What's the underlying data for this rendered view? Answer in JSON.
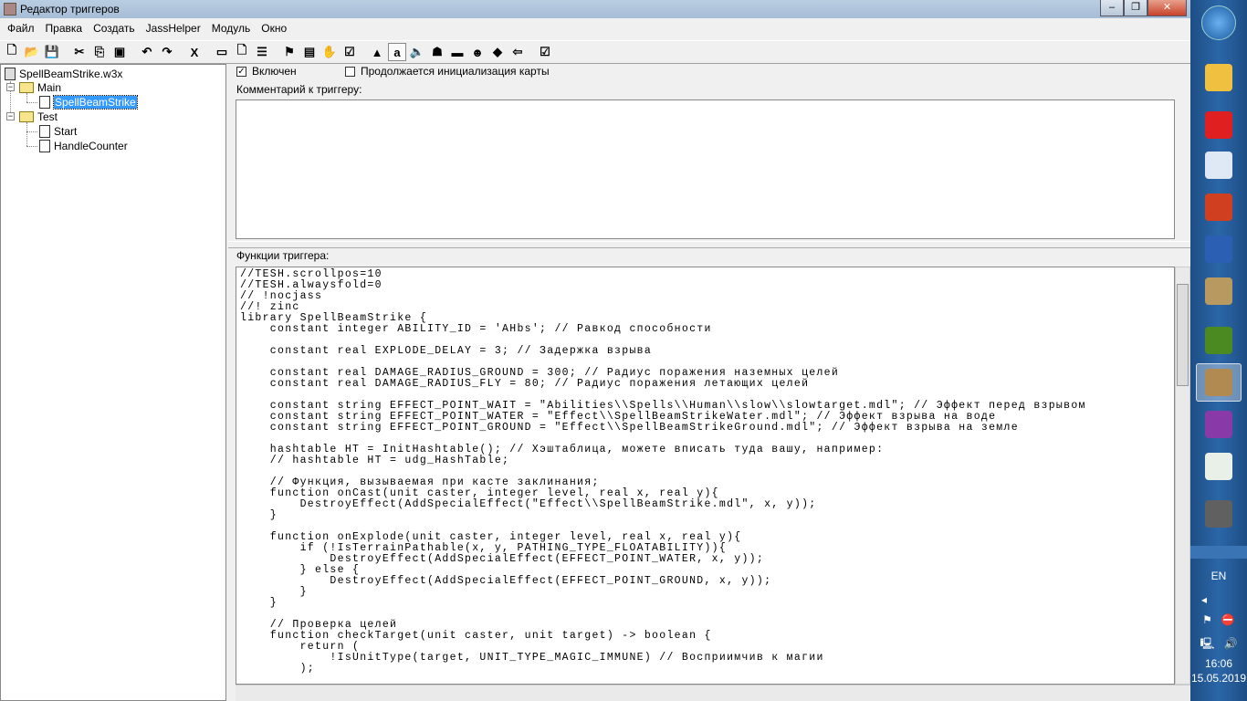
{
  "window": {
    "title": "Редактор триггеров",
    "minimize": "–",
    "maximize": "❐",
    "close": "✕"
  },
  "menu": [
    "Файл",
    "Правка",
    "Создать",
    "JassHelper",
    "Модуль",
    "Окно"
  ],
  "toolbar": [
    {
      "icon": "new-icon",
      "glyph": "🗋"
    },
    {
      "icon": "open-icon",
      "glyph": "📂"
    },
    {
      "icon": "save-icon",
      "glyph": "💾"
    },
    null,
    {
      "icon": "cut-icon",
      "glyph": "✂"
    },
    {
      "icon": "copy-icon",
      "glyph": "⎘"
    },
    {
      "icon": "paste-icon",
      "glyph": "▣"
    },
    null,
    {
      "icon": "undo-icon",
      "glyph": "↶"
    },
    {
      "icon": "redo-icon",
      "glyph": "↷"
    },
    null,
    {
      "icon": "jass-x-icon",
      "glyph": "X"
    },
    null,
    {
      "icon": "new-category-icon",
      "glyph": "▭"
    },
    {
      "icon": "new-trigger-icon",
      "glyph": "🗋"
    },
    {
      "icon": "new-comment-icon",
      "glyph": "☰"
    },
    null,
    {
      "icon": "new-event-icon",
      "glyph": "⚑"
    },
    {
      "icon": "new-condition-icon",
      "glyph": "▤"
    },
    {
      "icon": "new-action-icon",
      "glyph": "✋"
    },
    {
      "icon": "variables-icon",
      "glyph": "☑"
    },
    null,
    {
      "icon": "terrain-editor-icon",
      "glyph": "▲"
    },
    {
      "icon": "trigger-editor-icon",
      "glyph": "a",
      "pressed": true
    },
    {
      "icon": "sound-editor-icon",
      "glyph": "🔈"
    },
    {
      "icon": "object-editor-icon",
      "glyph": "☗"
    },
    {
      "icon": "campaign-editor-icon",
      "glyph": "▬"
    },
    {
      "icon": "ai-editor-icon",
      "glyph": "☻"
    },
    {
      "icon": "object-manager-icon",
      "glyph": "◆"
    },
    {
      "icon": "import-manager-icon",
      "glyph": "⇦"
    },
    null,
    {
      "icon": "test-map-icon",
      "glyph": "☑"
    }
  ],
  "tree": {
    "root": "SpellBeamStrike.w3x",
    "folders": [
      {
        "name": "Main",
        "items": [
          "SpellBeamStrike"
        ]
      },
      {
        "name": "Test",
        "items": [
          "Start",
          "HandleCounter"
        ]
      }
    ]
  },
  "trigger": {
    "enabled_label": "Включен",
    "enabled": true,
    "init_label": "Продолжается инициализация карты",
    "init": false,
    "comment_label": "Комментарий к триггеру:",
    "comment": "",
    "functions_label": "Функции триггера:"
  },
  "code": [
    "//TESH.scrollpos=10",
    "//TESH.alwaysfold=0",
    "// !nocjass",
    "//! zinc",
    "library SpellBeamStrike {",
    "    constant integer ABILITY_ID = 'AHbs'; // Равкод способности",
    "",
    "    constant real EXPLODE_DELAY = 3; // Задержка взрыва",
    "",
    "    constant real DAMAGE_RADIUS_GROUND = 300; // Радиус поражения наземных целей",
    "    constant real DAMAGE_RADIUS_FLY = 80; // Радиус поражения летающих целей",
    "",
    "    constant string EFFECT_POINT_WAIT = \"Abilities\\\\Spells\\\\Human\\\\slow\\\\slowtarget.mdl\"; // Эффект перед взрывом",
    "    constant string EFFECT_POINT_WATER = \"Effect\\\\SpellBeamStrikeWater.mdl\"; // Эффект взрыва на воде",
    "    constant string EFFECT_POINT_GROUND = \"Effect\\\\SpellBeamStrikeGround.mdl\"; // Эффект взрыва на земле",
    "",
    "    hashtable HT = InitHashtable(); // Хэштаблица, можете вписать туда вашу, например:",
    "    // hashtable HT = udg_HashTable;",
    "",
    "    // Функция, вызываемая при касте заклинания;",
    "    function onCast(unit caster, integer level, real x, real y){",
    "        DestroyEffect(AddSpecialEffect(\"Effect\\\\SpellBeamStrike.mdl\", x, y));",
    "    }",
    "",
    "    function onExplode(unit caster, integer level, real x, real y){",
    "        if (!IsTerrainPathable(x, y, PATHING_TYPE_FLOATABILITY)){",
    "            DestroyEffect(AddSpecialEffect(EFFECT_POINT_WATER, x, y));",
    "        } else {",
    "            DestroyEffect(AddSpecialEffect(EFFECT_POINT_GROUND, x, y));",
    "        }",
    "    }",
    "",
    "    // Проверка целей",
    "    function checkTarget(unit caster, unit target) -> boolean {",
    "        return (",
    "            !IsUnitType(target, UNIT_TYPE_MAGIC_IMMUNE) // Восприимчив к магии",
    "        );"
  ],
  "taskbar": {
    "apps": [
      {
        "name": "explorer",
        "color": "#f0c040"
      },
      {
        "name": "opera",
        "color": "#e02020"
      },
      {
        "name": "text-document",
        "color": "#dfe8f5"
      },
      {
        "name": "office",
        "color": "#d04020"
      },
      {
        "name": "word",
        "color": "#2b5fb4"
      },
      {
        "name": "scroll-app",
        "color": "#b89a60"
      },
      {
        "name": "orc-app",
        "color": "#4a8a20"
      },
      {
        "name": "world-editor",
        "color": "#b08a50",
        "active": true
      },
      {
        "name": "purple-app",
        "color": "#8a3aa8"
      },
      {
        "name": "window-app",
        "color": "#e8f0e8"
      },
      {
        "name": "game-app",
        "color": "#606060"
      }
    ],
    "lang": "EN",
    "time": "16:06",
    "date": "15.05.2019"
  }
}
